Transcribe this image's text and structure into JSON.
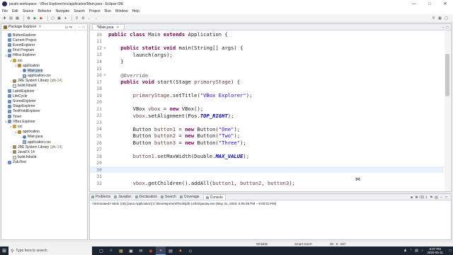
{
  "window": {
    "title": "javafx-workspace - VBox Explorer/src/application/Main.java - Eclipse IDE"
  },
  "menu": [
    "File",
    "Edit",
    "Source",
    "Refactor",
    "Navigate",
    "Search",
    "Project",
    "Run",
    "Window",
    "Help"
  ],
  "package_explorer": {
    "title": "Package Explorer",
    "items": [
      {
        "indent": 0,
        "twisty": "",
        "icon": "proj",
        "label": "ButtonExplorer",
        "deco": ""
      },
      {
        "indent": 0,
        "twisty": "",
        "icon": "proj",
        "label": "Current Project",
        "deco": ""
      },
      {
        "indent": 0,
        "twisty": "",
        "icon": "proj",
        "label": "EventExplorer",
        "deco": ""
      },
      {
        "indent": 0,
        "twisty": "",
        "icon": "proj",
        "label": "First Program",
        "deco": ""
      },
      {
        "indent": 0,
        "twisty": "v",
        "icon": "proj",
        "label": "HBox Explorer",
        "deco": ""
      },
      {
        "indent": 1,
        "twisty": "v",
        "icon": "folder",
        "label": "src",
        "deco": ""
      },
      {
        "indent": 2,
        "twisty": "v",
        "icon": "pkg",
        "label": "application",
        "deco": ""
      },
      {
        "indent": 3,
        "twisty": ">",
        "icon": "java",
        "label": "Main.java",
        "deco": "",
        "selected": true
      },
      {
        "indent": 3,
        "twisty": "",
        "icon": "css",
        "label": "application.css",
        "deco": ""
      },
      {
        "indent": 1,
        "twisty": ">",
        "icon": "lib",
        "label": "JRE System Library",
        "deco": "[jdk-14]"
      },
      {
        "indent": 1,
        "twisty": "",
        "icon": "file",
        "label": "build.fxbuild",
        "deco": ""
      },
      {
        "indent": 0,
        "twisty": "",
        "icon": "proj",
        "label": "LabelExplorer",
        "deco": ""
      },
      {
        "indent": 0,
        "twisty": "",
        "icon": "proj",
        "label": "LifeCycle",
        "deco": ""
      },
      {
        "indent": 0,
        "twisty": "",
        "icon": "proj",
        "label": "SceneExplorer",
        "deco": ""
      },
      {
        "indent": 0,
        "twisty": "",
        "icon": "proj",
        "label": "StageExplorer",
        "deco": ""
      },
      {
        "indent": 0,
        "twisty": "",
        "icon": "proj",
        "label": "TextFieldExplorer",
        "deco": ""
      },
      {
        "indent": 0,
        "twisty": "",
        "icon": "proj",
        "label": "Timer",
        "deco": ""
      },
      {
        "indent": 0,
        "twisty": "v",
        "icon": "proj",
        "label": "VBox Explorer",
        "deco": ""
      },
      {
        "indent": 1,
        "twisty": "v",
        "icon": "folder",
        "label": "src",
        "deco": ""
      },
      {
        "indent": 2,
        "twisty": "v",
        "icon": "pkg",
        "label": "application",
        "deco": ""
      },
      {
        "indent": 3,
        "twisty": ">",
        "icon": "java",
        "label": "Main.java",
        "deco": ""
      },
      {
        "indent": 3,
        "twisty": "",
        "icon": "css",
        "label": "application.css",
        "deco": ""
      },
      {
        "indent": 1,
        "twisty": ">",
        "icon": "lib",
        "label": "JRE System Library",
        "deco": "[jdk-14]"
      },
      {
        "indent": 1,
        "twisty": ">",
        "icon": "lib",
        "label": "JavaFX 14",
        "deco": ""
      },
      {
        "indent": 1,
        "twisty": "",
        "icon": "file",
        "label": "build.fxbuild",
        "deco": ""
      },
      {
        "indent": 0,
        "twisty": "",
        "icon": "proj",
        "label": "ZuluTest",
        "deco": ""
      }
    ]
  },
  "editor": {
    "tab_label": "*Main.java",
    "lines": [
      {
        "num": "10",
        "fold": "",
        "html": "<span class=\"kw\">public class</span> Main <span class=\"kw\">extends</span> Application {"
      },
      {
        "num": "11",
        "fold": "",
        "html": ""
      },
      {
        "num": "12",
        "fold": "⊖",
        "html": "    <span class=\"kw\">public static void</span> main(String[] args) {"
      },
      {
        "num": "13",
        "fold": "",
        "html": "        launch(args);"
      },
      {
        "num": "14",
        "fold": "",
        "html": "    }"
      },
      {
        "num": "15",
        "fold": "",
        "html": ""
      },
      {
        "num": "16",
        "fold": "⊖",
        "html": "    <span class=\"ann\">@Override</span>"
      },
      {
        "num": "17",
        "fold": "",
        "html": "    <span class=\"kw\">public void</span> start(Stage <span class=\"var\">primaryStage</span>) {"
      },
      {
        "num": "18",
        "fold": "",
        "html": ""
      },
      {
        "num": "19",
        "fold": "",
        "html": "        <span class=\"var\">primaryStage</span>.setTitle(<span class=\"str\">\"VBox Explorer\"</span>);"
      },
      {
        "num": "20",
        "fold": "",
        "html": ""
      },
      {
        "num": "21",
        "fold": "",
        "html": "        VBox <span class=\"var\">vbox</span> = <span class=\"kw\">new</span> VBox();"
      },
      {
        "num": "22",
        "fold": "",
        "html": "        <span class=\"var\">vbox</span>.setAlignment(Pos.<span class=\"fld\">TOP_RIGHT</span>);"
      },
      {
        "num": "23",
        "fold": "",
        "html": ""
      },
      {
        "num": "24",
        "fold": "",
        "html": "        Button <span class=\"var\">button1</span> = <span class=\"kw\">new</span> Button(<span class=\"str\">\"One\"</span>);"
      },
      {
        "num": "25",
        "fold": "",
        "html": "        Button <span class=\"var\">button2</span> = <span class=\"kw\">new</span> Button(<span class=\"str\">\"Two\"</span>);"
      },
      {
        "num": "26",
        "fold": "",
        "html": "        Button <span class=\"var\">button3</span> = <span class=\"kw\">new</span> Button(<span class=\"str\">\"Three\"</span>);"
      },
      {
        "num": "27",
        "fold": "",
        "html": ""
      },
      {
        "num": "28",
        "fold": "",
        "html": "        <span class=\"var\">button1</span>.setMaxWidth(Double.<span class=\"fld\">MAX_VALUE</span>);"
      },
      {
        "num": "29",
        "fold": "",
        "html": ""
      },
      {
        "num": "30",
        "fold": "",
        "html": "",
        "current": true
      },
      {
        "num": "31",
        "fold": "",
        "html": ""
      },
      {
        "num": "32",
        "fold": "",
        "html": "        <span class=\"var\">vbox</span>.getChildren().addAll(<span class=\"var\">button1</span>, <span class=\"var\">button2</span>, <span class=\"var\">button3</span>);"
      }
    ]
  },
  "bottom_panel": {
    "tabs": [
      "Problems",
      "Javadoc",
      "Declaration",
      "Search",
      "Coverage",
      "Console"
    ],
    "active_tab": "Console",
    "console_text": "<terminated> Main (19) [Java Application] C:\\Development\\Tools\\jdk-14\\bin\\javaw.exe (May 31, 2020, 6:05:35 PM – 6:06:02 PM)"
  },
  "status": {
    "writable": "Writable",
    "insert_mode": "Smart Insert",
    "position": "30 : 9 : 667"
  },
  "taskbar": {
    "search_placeholder": "Type here to search",
    "time": "6:07 PM",
    "date": "2020-05-31"
  }
}
